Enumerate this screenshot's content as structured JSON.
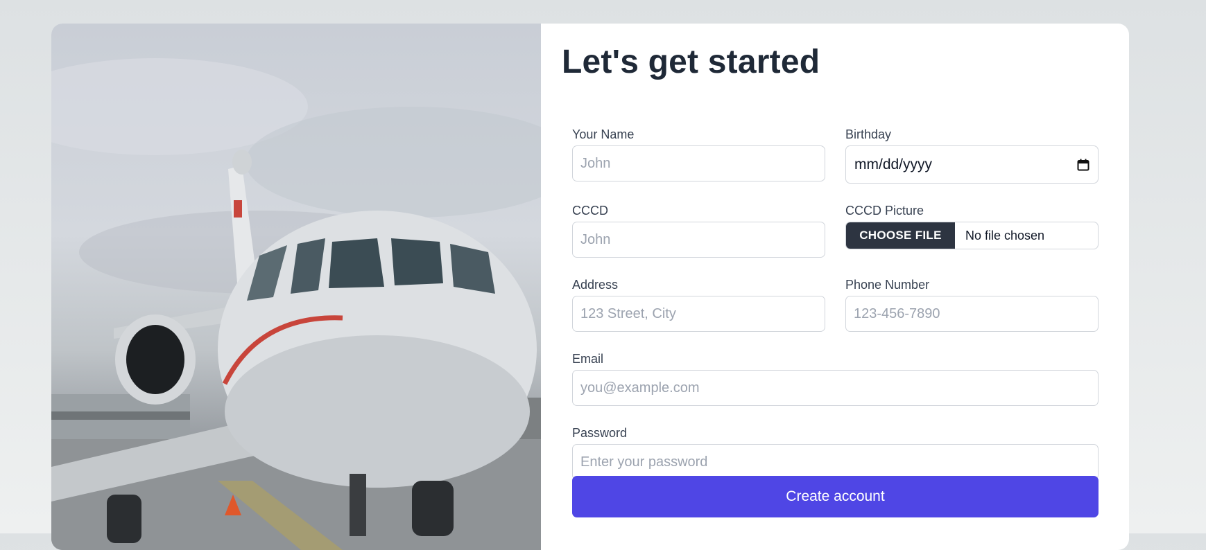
{
  "form": {
    "title": "Let's get started",
    "name": {
      "label": "Your Name",
      "placeholder": "John"
    },
    "birthday": {
      "label": "Birthday",
      "value": "mm/dd/yyyy"
    },
    "cccd": {
      "label": "CCCD",
      "placeholder": "John"
    },
    "cccd_picture": {
      "label": "CCCD Picture",
      "button": "CHOOSE FILE",
      "status": "No file chosen"
    },
    "address": {
      "label": "Address",
      "placeholder": "123 Street, City"
    },
    "phone": {
      "label": "Phone Number",
      "placeholder": "123-456-7890"
    },
    "email": {
      "label": "Email",
      "placeholder": "you@example.com"
    },
    "password": {
      "label": "Password",
      "placeholder": "Enter your password"
    },
    "submit_label": "Create account"
  },
  "colors": {
    "accent": "#4f46e5",
    "file_button": "#2d3441",
    "title": "#1f2937"
  },
  "icons": {
    "birthday": "calendar-icon"
  }
}
